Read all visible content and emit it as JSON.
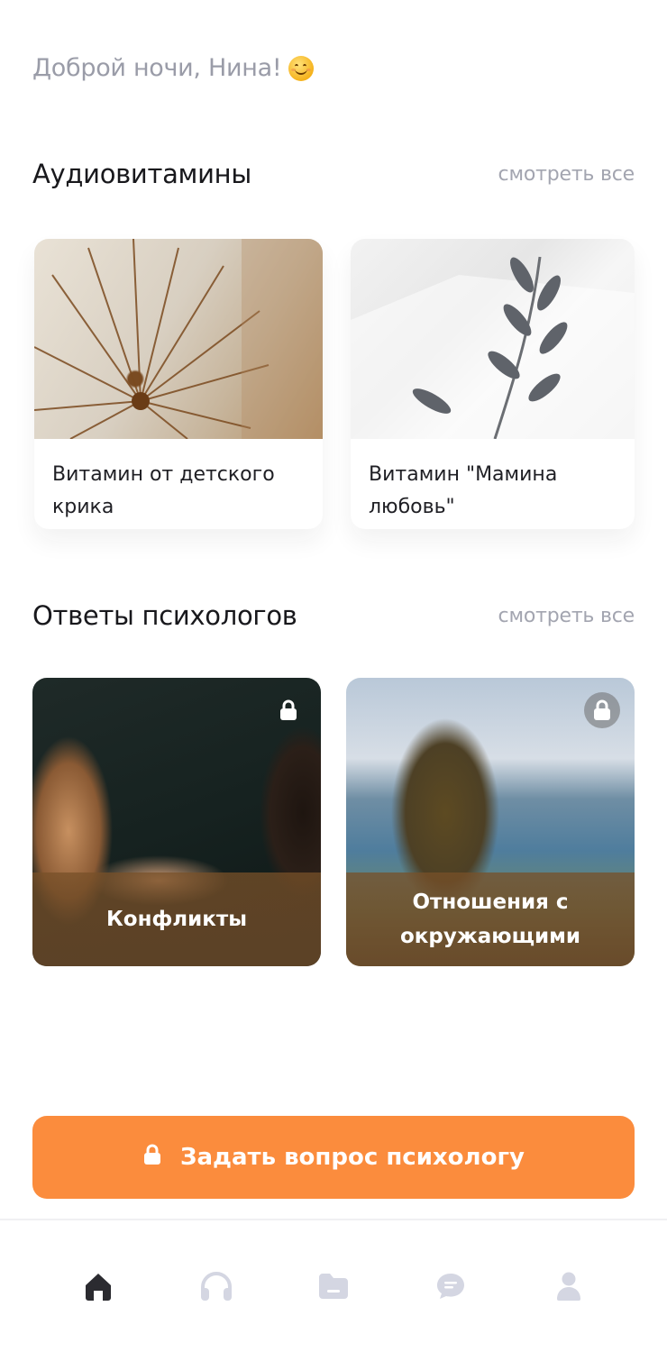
{
  "greeting": "Доброй ночи, Нина!",
  "audio": {
    "title": "Аудиовитамины",
    "see_all": "смотреть все",
    "items": [
      {
        "label": "Витамин от детского крика"
      },
      {
        "label": "Витамин \"Мамина любовь\""
      }
    ]
  },
  "psychologists": {
    "title": "Ответы психологов",
    "see_all": "смотреть все",
    "items": [
      {
        "label": "Конфликты",
        "locked": true
      },
      {
        "label": "Отношения с окружающими",
        "locked": true
      }
    ]
  },
  "cta": {
    "label": "Задать вопрос психологу",
    "icon": "lock-icon"
  },
  "tabs": [
    {
      "icon": "home-icon",
      "active": true
    },
    {
      "icon": "headphones-icon",
      "active": false
    },
    {
      "icon": "folder-icon",
      "active": false
    },
    {
      "icon": "chat-icon",
      "active": false
    },
    {
      "icon": "profile-icon",
      "active": false
    }
  ],
  "colors": {
    "accent": "#fb8c3d",
    "muted": "#a3a5b0",
    "tab_active": "#2b2b30",
    "tab_inactive": "#d4d6e2"
  }
}
